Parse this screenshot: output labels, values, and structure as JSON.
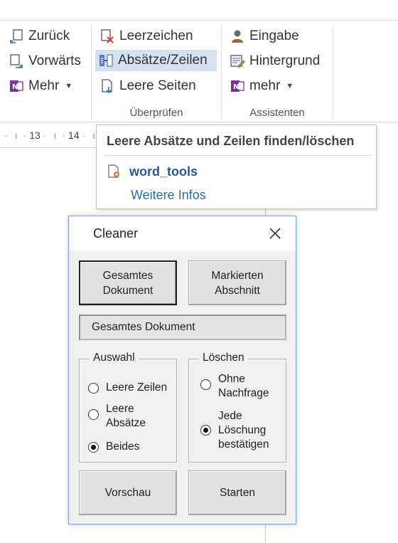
{
  "ribbon": {
    "group1": {
      "back_label": "Zurück",
      "forward_label": "Vorwärts",
      "more_label": "Mehr"
    },
    "group_check": {
      "spaces_label": "Leerzeichen",
      "paragraphs_label": "Absätze/Zeilen",
      "empty_pages_label": "Leere Seiten",
      "group_label": "Überprüfen"
    },
    "group_assist": {
      "input_label": "Eingabe",
      "background_label": "Hintergrund",
      "more_label": "mehr",
      "group_label": "Assistenten"
    }
  },
  "ruler": {
    "mark_13": "13",
    "mark_14": "14"
  },
  "tooltip": {
    "title": "Leere Absätze und Zeilen finden/löschen",
    "addin_name": "word_tools",
    "more_info": "Weitere Infos"
  },
  "dialog": {
    "title": "Cleaner",
    "btn_whole_doc_line1": "Gesamtes",
    "btn_whole_doc_line2": "Dokument",
    "btn_selection_line1": "Markierten",
    "btn_selection_line2": "Abschnitt",
    "status_text": "Gesamtes Dokument",
    "selection_group": {
      "legend": "Auswahl",
      "opt_empty_lines": "Leere Zeilen",
      "opt_empty_paragraphs_line1": "Leere",
      "opt_empty_paragraphs_line2": "Absätze",
      "opt_both": "Beides",
      "selected": "Beides"
    },
    "delete_group": {
      "legend": "Löschen",
      "opt_no_prompt_line1": "Ohne",
      "opt_no_prompt_line2": "Nachfrage",
      "opt_confirm_line1": "Jede",
      "opt_confirm_line2": "Löschung",
      "opt_confirm_line3": "bestätigen",
      "selected": "Jede Löschung bestätigen"
    },
    "btn_preview": "Vorschau",
    "btn_start": "Starten"
  },
  "colors": {
    "accent_blue": "#2b579a",
    "link_blue": "#2b6cb0",
    "active_highlight": "#d5e1f2",
    "dialog_border": "#7aa7d6"
  }
}
